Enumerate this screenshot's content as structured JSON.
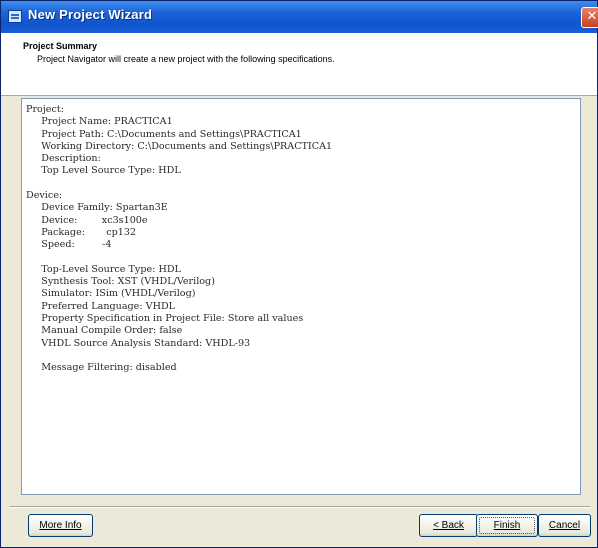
{
  "window": {
    "title": "New Project Wizard",
    "close_glyph": "✕"
  },
  "header": {
    "title": "Project Summary",
    "subtitle": "Project Navigator will create a new project with the following specifications."
  },
  "summary": {
    "text": "Project:\n     Project Name: PRACTICA1\n     Project Path: C:\\Documents and Settings\\PRACTICA1\n     Working Directory: C:\\Documents and Settings\\PRACTICA1\n     Description:\n     Top Level Source Type: HDL\n\nDevice:\n     Device Family: Spartan3E\n     Device:        xc3s100e\n     Package:       cp132\n     Speed:         -4\n\n     Top-Level Source Type: HDL\n     Synthesis Tool: XST (VHDL/Verilog)\n     Simulator: ISim (VHDL/Verilog)\n     Preferred Language: VHDL\n     Property Specification in Project File: Store all values\n     Manual Compile Order: false\n     VHDL Source Analysis Standard: VHDL-93\n\n     Message Filtering: disabled"
  },
  "buttons": {
    "more_info": "More Info",
    "back": "< Back",
    "finish": "Finish",
    "cancel": "Cancel"
  },
  "icons": {
    "app": "wizard-app-icon",
    "close": "close-icon"
  },
  "colors": {
    "titlebar": "#1e64d8",
    "dialog_bg": "#ece9d8",
    "close": "#d2502c"
  }
}
